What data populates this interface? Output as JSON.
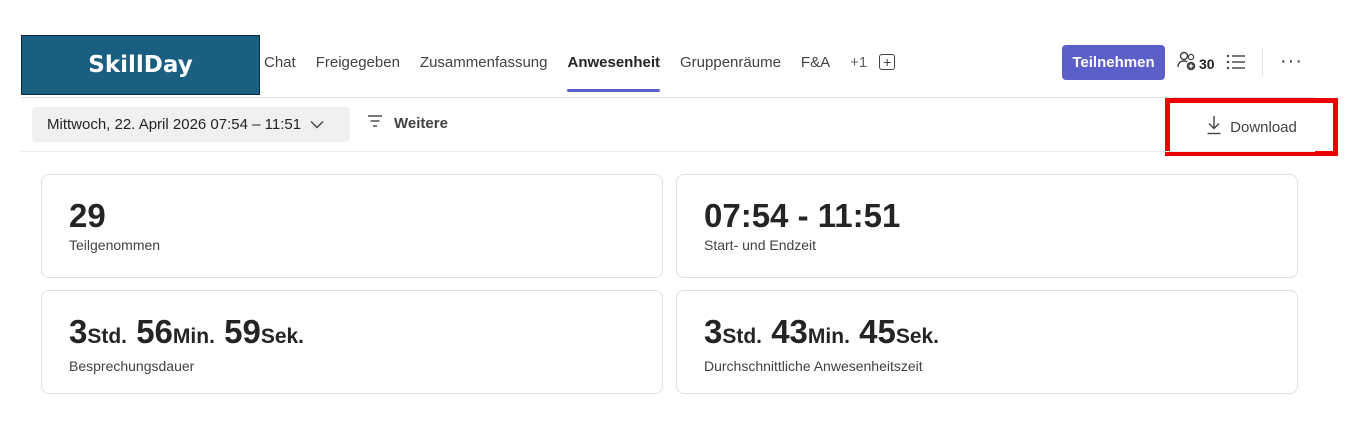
{
  "logo": {
    "text": "SkillDay"
  },
  "tabs": [
    {
      "label": "Chat"
    },
    {
      "label": "Freigegeben"
    },
    {
      "label": "Zusammenfassung"
    },
    {
      "label": "Anwesenheit",
      "active": true
    },
    {
      "label": "Gruppenräume"
    },
    {
      "label": "F&A"
    },
    {
      "label": "+1"
    }
  ],
  "header": {
    "join_label": "Teilnehmen",
    "participant_count": "30",
    "accent_color": "#5b5fc7"
  },
  "toolbar": {
    "date_range": "Mittwoch, 22. April 2026 07:54 – 11:51",
    "filter_label": "Weitere",
    "download_label": "Download"
  },
  "stats": {
    "participants": {
      "value": "29",
      "label": "Teilgenommen"
    },
    "time": {
      "value": "07:54 - 11:51",
      "label": "Start- und Endzeit"
    },
    "duration": {
      "h": "3",
      "h_unit": "Std.",
      "m": "56",
      "m_unit": "Min.",
      "s": "59",
      "s_unit": "Sek.",
      "label": "Besprechungsdauer"
    },
    "avg": {
      "h": "3",
      "h_unit": "Std.",
      "m": "43",
      "m_unit": "Min.",
      "s": "45",
      "s_unit": "Sek.",
      "label": "Durchschnittliche Anwesenheitszeit"
    }
  },
  "icons": [
    "people-add-icon",
    "list-icon",
    "more-icon",
    "chevron-down-icon",
    "filter-icon",
    "download-icon",
    "add-tab-icon"
  ],
  "highlight_color": "#ee0000"
}
